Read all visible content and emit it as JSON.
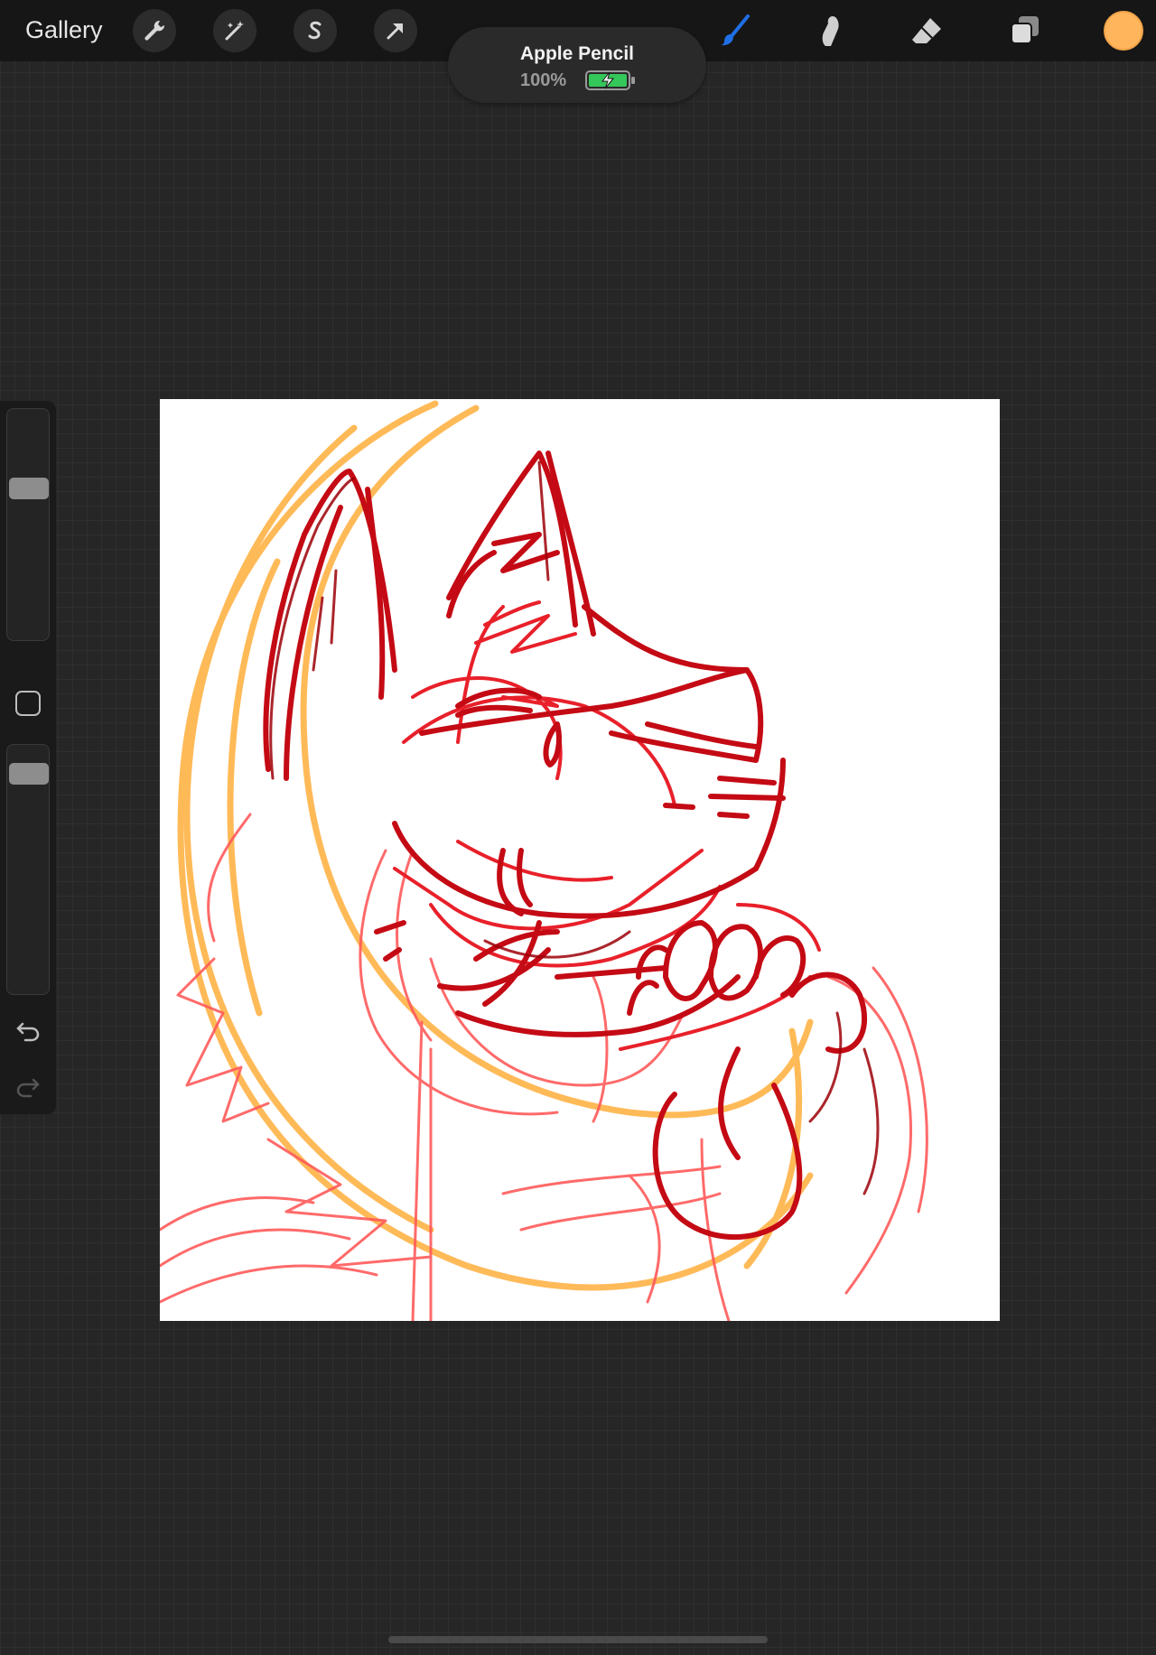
{
  "toolbar": {
    "gallery_label": "Gallery",
    "left_tools": [
      "wrench-icon",
      "magic-wand-icon",
      "selection-s-icon",
      "transform-arrow-icon"
    ],
    "right_tools": [
      "brush-icon",
      "smudge-icon",
      "eraser-icon",
      "layers-icon"
    ],
    "active_tool": "brush-icon",
    "accent_color": "#1f6fe5",
    "current_color": "#ffb55c"
  },
  "pencil_status": {
    "name": "Apple Pencil",
    "level": "100%",
    "battery_color": "#34c759"
  },
  "sidebar": {
    "brush_size_level": 0.35,
    "opacity_level": 0.9,
    "modify_button": "square-icon",
    "undo": "undo-icon",
    "redo": "redo-icon"
  },
  "canvas": {
    "content": "sketch-drawing",
    "stroke_colors": [
      "#c40a14",
      "#e8202a",
      "#ff5a5a",
      "#ffb347"
    ]
  }
}
